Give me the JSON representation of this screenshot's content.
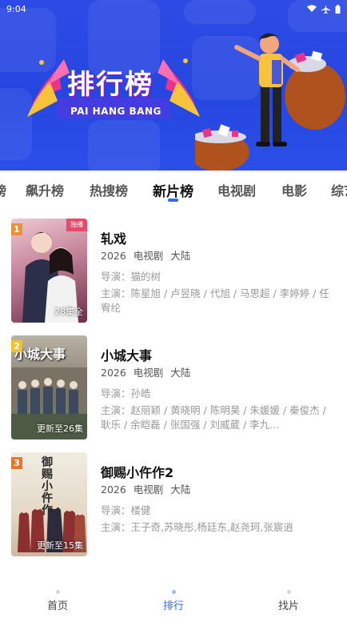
{
  "status_bar": {
    "time": "9:04",
    "icons": [
      "wifi-icon",
      "airplane-icon",
      "battery-icon"
    ]
  },
  "banner": {
    "title": "排行榜",
    "subtitle": "PAI HANG BANG",
    "colors": {
      "background": "#2646e0",
      "accent_pink": "#e8348a",
      "accent_yellow": "#f6c33b"
    }
  },
  "tabs": [
    {
      "label": "榜",
      "active": false
    },
    {
      "label": "飙升榜",
      "active": false
    },
    {
      "label": "热搜榜",
      "active": false
    },
    {
      "label": "新片榜",
      "active": true
    },
    {
      "label": "电视剧",
      "active": false
    },
    {
      "label": "电影",
      "active": false
    },
    {
      "label": "综艺",
      "active": false
    }
  ],
  "items": [
    {
      "rank": "1",
      "rank_color": "#e8913b",
      "title": "轧戏",
      "year": "2026",
      "type": "电视剧",
      "region": "大陆",
      "director": "导演：猫的树",
      "cast": "主演：陈星旭 / 卢昱晓 / 代旭 / 马思超 / 李婷婷 / 任宥纶",
      "poster_status": "28集全",
      "poster_corner": "独播",
      "poster_colors": [
        "#d9a4b3",
        "#7c3b55"
      ]
    },
    {
      "rank": "2",
      "rank_color": "#f2c12e",
      "title": "小城大事",
      "year": "2026",
      "type": "电视剧",
      "region": "大陆",
      "director": "导演：孙皓",
      "cast": "主演：赵丽颖 / 黄晓明 / 陈明昊 / 朱媛媛 / 秦俊杰 / 耿乐 / 余皑磊 / 张国强 / 刘威葳 / 李九...",
      "poster_status": "更新至26集",
      "poster_text": "小城大事",
      "poster_colors": [
        "#8e8a7f",
        "#4b5a4c"
      ]
    },
    {
      "rank": "3",
      "rank_color": "#e6762e",
      "title": "御赐小仵作2",
      "year": "2026",
      "type": "电视剧",
      "region": "大陆",
      "director": "导演：楼健",
      "cast": "主演：王子奇,苏晓彤,杨廷东,赵尧珂,张宸逍",
      "poster_status": "更新至15集",
      "poster_text": "御赐小仵作",
      "poster_colors": [
        "#e8e2d6",
        "#9a3b3b"
      ]
    }
  ],
  "bottom_nav": [
    {
      "label": "首页",
      "active": false
    },
    {
      "label": "排行",
      "active": true
    },
    {
      "label": "找片",
      "active": false
    }
  ]
}
